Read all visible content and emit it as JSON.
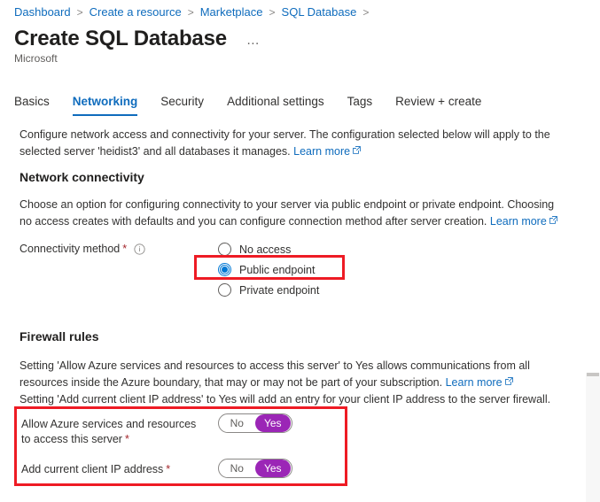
{
  "breadcrumb": {
    "items": [
      "Dashboard",
      "Create a resource",
      "Marketplace",
      "SQL Database"
    ],
    "separator": ">"
  },
  "header": {
    "title": "Create SQL Database",
    "subtitle": "Microsoft",
    "more_menu": "…"
  },
  "tabs": [
    {
      "label": "Basics",
      "active": false
    },
    {
      "label": "Networking",
      "active": true
    },
    {
      "label": "Security",
      "active": false
    },
    {
      "label": "Additional settings",
      "active": false
    },
    {
      "label": "Tags",
      "active": false
    },
    {
      "label": "Review + create",
      "active": false
    }
  ],
  "intro": {
    "text": "Configure network access and connectivity for your server. The configuration selected below will apply to the selected server 'heidist3' and all databases it manages.",
    "link": "Learn more"
  },
  "network_connectivity": {
    "heading": "Network connectivity",
    "description": "Choose an option for configuring connectivity to your server via public endpoint or private endpoint. Choosing no access creates with defaults and you can configure connection method after server creation.",
    "link": "Learn more",
    "field_label": "Connectivity method",
    "required_marker": "*",
    "options": [
      {
        "label": "No access",
        "selected": false
      },
      {
        "label": "Public endpoint",
        "selected": true
      },
      {
        "label": "Private endpoint",
        "selected": false
      }
    ]
  },
  "firewall_rules": {
    "heading": "Firewall rules",
    "description_line1": "Setting 'Allow Azure services and resources to access this server' to Yes allows communications from all resources inside the Azure boundary, that may or may not be part of your subscription.",
    "link": "Learn more",
    "description_line2": "Setting 'Add current client IP address' to Yes will add an entry for your client IP address to the server firewall.",
    "toggles": [
      {
        "label": "Allow Azure services and resources to access this server",
        "required_marker": "*",
        "off_label": "No",
        "on_label": "Yes",
        "value": "Yes"
      },
      {
        "label": "Add current client IP address",
        "required_marker": "*",
        "off_label": "No",
        "on_label": "Yes",
        "value": "Yes"
      }
    ]
  },
  "colors": {
    "link_blue": "#0f6cbd",
    "radio_blue": "#0078d4",
    "toggle_purple": "#9b26b6",
    "annotation_red": "#ee1b24",
    "required_red": "#a4262c"
  }
}
